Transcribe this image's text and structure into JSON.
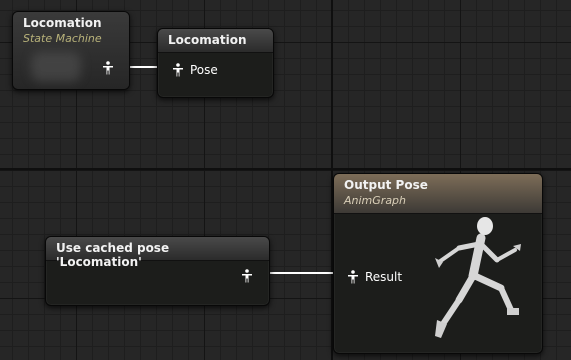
{
  "nodes": {
    "state_machine": {
      "title": "Locomation",
      "subtitle": "State Machine"
    },
    "locomation": {
      "title": "Locomation",
      "pin_label": "Pose"
    },
    "cached_pose": {
      "title": "Use cached pose 'Locomation'"
    },
    "output_pose": {
      "title": "Output Pose",
      "subtitle": "AnimGraph",
      "pin_label": "Result"
    }
  },
  "icons": {
    "pin": "pose-pin-icon",
    "preview": "running-mannequin-icon"
  },
  "colors": {
    "wire": "#ffffff",
    "subtitle": "#b8b27a",
    "output_header": "#7d6d58"
  }
}
